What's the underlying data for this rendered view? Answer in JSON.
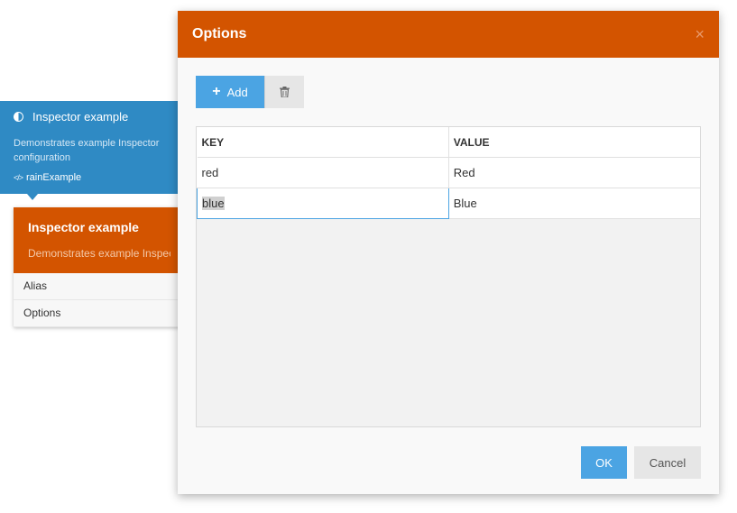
{
  "component": {
    "title": "Inspector example",
    "description": "Demonstrates example Inspector configuration",
    "alias": "rainExample"
  },
  "inspector": {
    "title": "Inspector example",
    "description": "Demonstrates example Inspector configuration",
    "properties": [
      "Alias",
      "Options"
    ]
  },
  "modal": {
    "title": "Options",
    "close": "×",
    "add_label": "Add",
    "ok_label": "OK",
    "cancel_label": "Cancel",
    "columns": [
      "KEY",
      "VALUE"
    ],
    "rows": [
      {
        "key": "red",
        "value": "Red"
      },
      {
        "key": "blue",
        "value": "Blue"
      }
    ]
  },
  "colors": {
    "accent_orange": "#d35400",
    "component_blue": "#2f8ac4",
    "button_blue": "#4ba4e3"
  },
  "icons": {
    "component": "half-circle-icon",
    "alias": "code-icon",
    "add": "plus-icon",
    "delete": "trash-icon",
    "close": "close-icon"
  }
}
